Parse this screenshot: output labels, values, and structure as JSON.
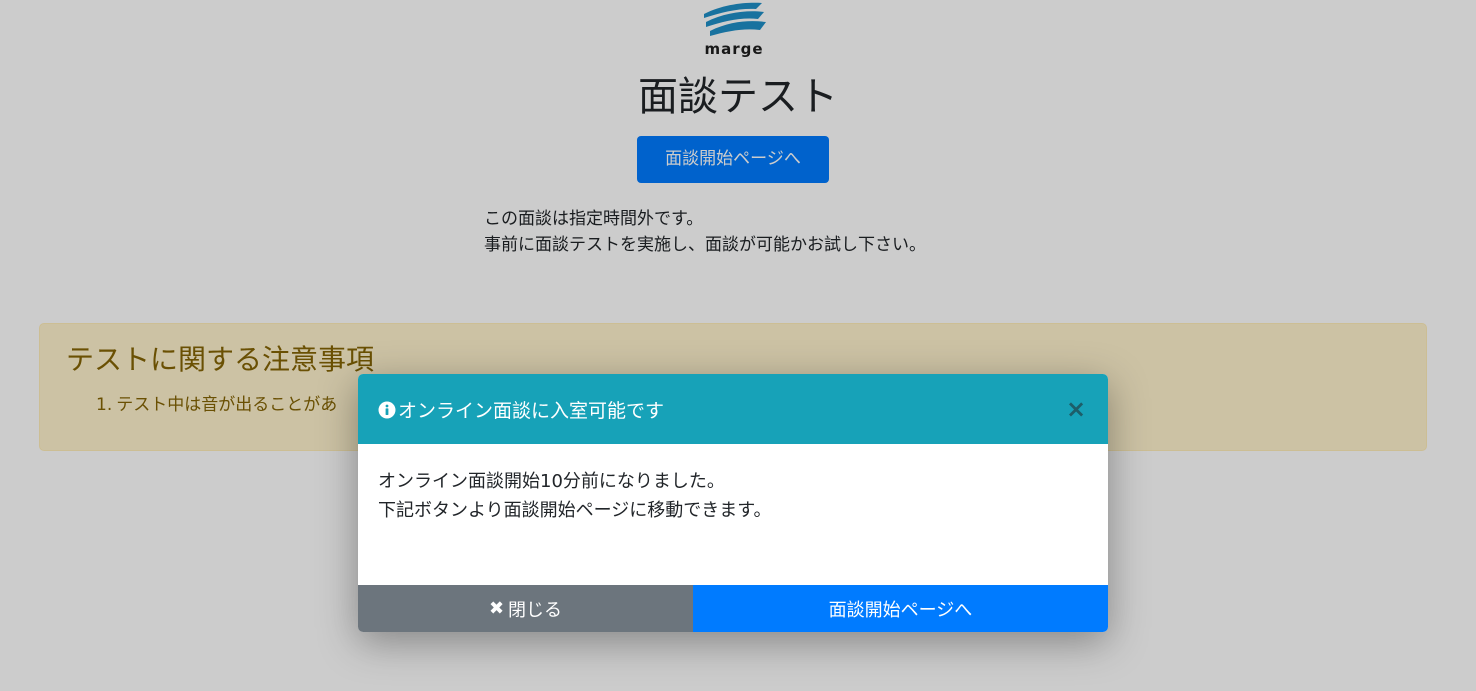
{
  "logo": {
    "text": "marge",
    "icon": "wave-logo-icon"
  },
  "page": {
    "title": "面談テスト",
    "start_button_label": "面談開始ページへ",
    "notice_lines": [
      "この面談は指定時間外です。",
      "事前に面談テストを実施し、面談が可能かお試し下さい。"
    ]
  },
  "warning": {
    "title": "テストに関する注意事項",
    "items": [
      {
        "num": "1.",
        "text": "テスト中は音が出ることがあ"
      }
    ]
  },
  "modal": {
    "title": "オンライン面談に入室可能です",
    "close_symbol": "×",
    "body_lines": [
      "オンライン面談開始10分前になりました。",
      "下記ボタンより面談開始ページに移動できます。"
    ],
    "close_button_icon": "✖",
    "close_button_label": "閉じる",
    "start_button_label": "面談開始ページへ"
  },
  "colors": {
    "primary": "#007bff",
    "info": "#17a2b8",
    "secondary": "#6c757d",
    "warning_bg": "#fff3cd",
    "warning_text": "#856404"
  }
}
